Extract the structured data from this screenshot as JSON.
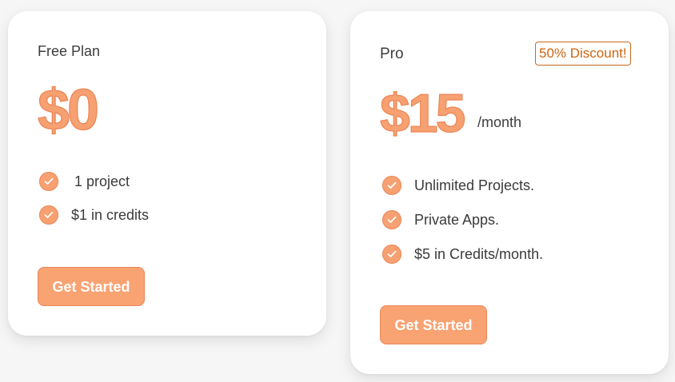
{
  "theme": {
    "accent": "#f7a071",
    "accent_border": "#eb8553",
    "badge_color": "#cc6410",
    "text": "#3d3d3d",
    "card_bg": "#ffffff"
  },
  "plans": [
    {
      "name": "Free Plan",
      "price": "$0",
      "period": "",
      "badge": "",
      "features": [
        {
          "label": "1 project",
          "icon": "check-circle-icon"
        },
        {
          "label": "$1 in credits",
          "icon": "check-circle-icon"
        }
      ],
      "cta": "Get Started"
    },
    {
      "name": "Pro",
      "price": "$15",
      "period": "/month",
      "badge": "50% Discount!",
      "features": [
        {
          "label": "Unlimited Projects.",
          "icon": "check-circle-icon"
        },
        {
          "label": "Private Apps.",
          "icon": "check-circle-icon"
        },
        {
          "label": "$5 in Credits/month.",
          "icon": "check-circle-icon"
        }
      ],
      "cta": "Get Started"
    }
  ]
}
